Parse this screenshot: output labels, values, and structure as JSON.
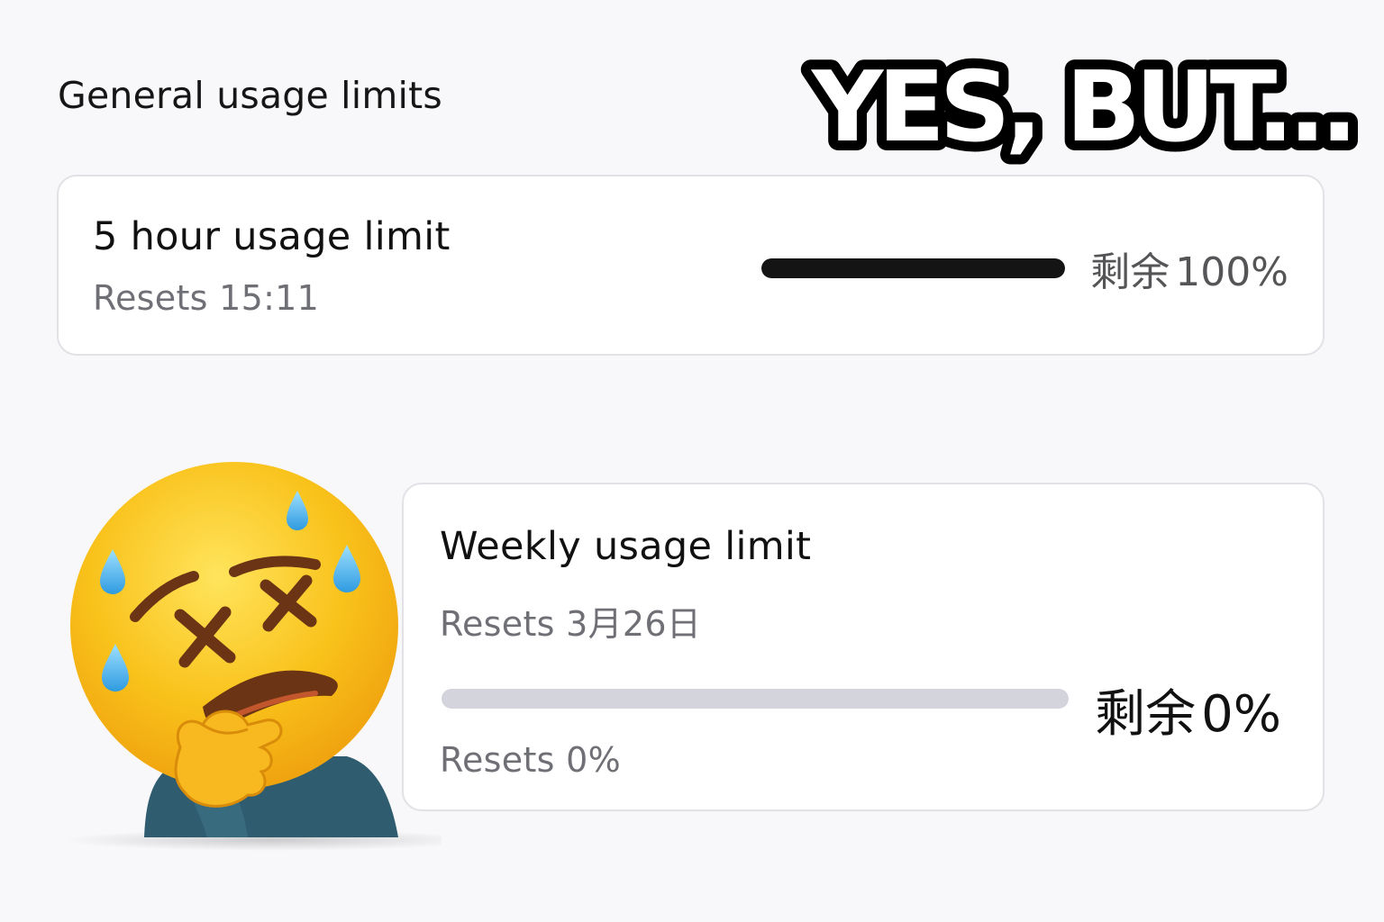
{
  "header": {
    "title": "General usage limits",
    "meme_caption": "YES, BUT..."
  },
  "limits": [
    {
      "title": "5 hour usage limit",
      "reset_text": "Resets 15:11",
      "remaining_label": "剩余",
      "remaining_value": "100%",
      "remaining_fraction": 1.0
    },
    {
      "title": "Weekly usage limit",
      "reset_text": "Resets 3月26日",
      "remaining_label": "剩余",
      "remaining_value": "0%",
      "remaining_fraction": 0.0,
      "footer_text": "Resets 0%"
    }
  ],
  "icons": {
    "emoji": "dizzy-thinking-sweat-face-icon"
  },
  "colors": {
    "bar_fill": "#141414",
    "bar_track": "#d4d5dc",
    "card_border": "#e2e2e6",
    "muted_text": "#6f6f76",
    "emoji_yellow": "#f9c21b"
  }
}
